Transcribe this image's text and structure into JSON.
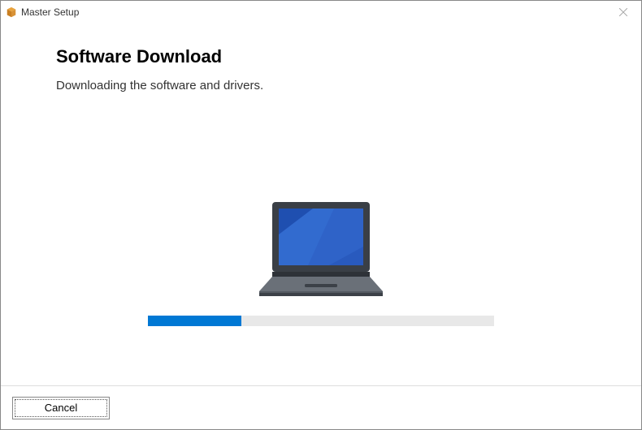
{
  "titlebar": {
    "app_name": "Master Setup"
  },
  "content": {
    "heading": "Software Download",
    "subtext": "Downloading the software and drivers."
  },
  "progress": {
    "percent": 27
  },
  "footer": {
    "cancel_label": "Cancel"
  },
  "icons": {
    "app": "box-icon",
    "close": "close-icon",
    "illustration": "laptop-icon"
  },
  "colors": {
    "accent": "#0078d4",
    "screen_dark": "#1f4fb0",
    "screen_light": "#3a74d9",
    "laptop_body_dark": "#3a3f46",
    "laptop_body_light": "#6a7078"
  }
}
